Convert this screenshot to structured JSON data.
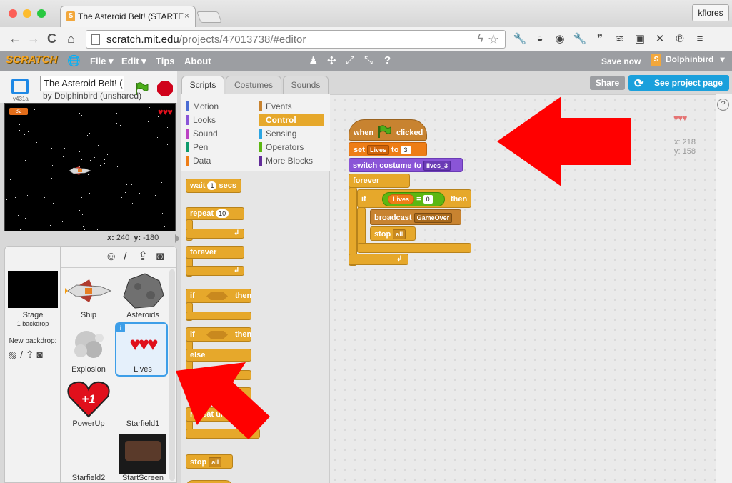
{
  "browser": {
    "tab_title": "The Asteroid Belt! (STARTE",
    "tab_favicon": "S",
    "tab_close": "×",
    "user": "kflores",
    "url_host": "scratch.mit.edu",
    "url_path": "/projects/47013738/#editor",
    "nav_back": "←",
    "nav_forward": "→",
    "nav_reload": "C",
    "nav_home": "⌂",
    "url_bolt": "ϟ",
    "url_star": "☆",
    "extensions": [
      "wrench-icon",
      "pocket-icon",
      "mask-icon",
      "wrench-icon",
      "hangouts-icon",
      "layers-icon",
      "window-icon",
      "kaltura-icon",
      "pinterest-icon",
      "menu-icon"
    ],
    "extension_glyphs": [
      "🔧",
      "◒",
      "◉",
      "🔧",
      "❞",
      "≋",
      "▣",
      "✕",
      "℗",
      "≡"
    ]
  },
  "scratch_menu": {
    "logo": "SCRATCH",
    "globe": "🌐",
    "file": "File ▾",
    "edit": "Edit ▾",
    "tips": "Tips",
    "about": "About",
    "tool_glyphs": [
      "♟",
      "✣",
      "⤢",
      "⤡",
      "?"
    ],
    "save_now": "Save now",
    "username": "Dolphinbird",
    "user_badge": "S",
    "user_caret": "▾"
  },
  "stage_header": {
    "version": "v431a",
    "project_title": "The Asteroid Belt! (",
    "author_line": "by Dolphinbird (unshared)"
  },
  "stage": {
    "score": "32",
    "hearts": "♥♥♥",
    "mouse_x_label": "x:",
    "mouse_x": "240",
    "mouse_y_label": "y:",
    "mouse_y": "-180"
  },
  "sprite_pane": {
    "toolbar_glyphs": [
      "☺",
      "/",
      "⇪",
      "◙"
    ],
    "stage_label": "Stage",
    "backdrop_count": "1 backdrop",
    "new_backdrop_label": "New backdrop:",
    "new_backdrop_tools": "▨ / ⇪ ◙",
    "info": "i",
    "sprites": [
      "Ship",
      "Asteroids",
      "Explosion",
      "Lives",
      "PowerUp",
      "Starfield1",
      "Starfield2",
      "StartScreen"
    ],
    "powerup_text": "+1",
    "selected_sprite": "Lives"
  },
  "tabs": [
    "Scripts",
    "Costumes",
    "Sounds"
  ],
  "active_tab": "Scripts",
  "categories": [
    {
      "label": "Motion",
      "color": "#4a6cd4"
    },
    {
      "label": "Looks",
      "color": "#8a55d7"
    },
    {
      "label": "Sound",
      "color": "#bb42c3"
    },
    {
      "label": "Pen",
      "color": "#0e9a6c"
    },
    {
      "label": "Data",
      "color": "#ee7d16"
    },
    {
      "label": "Events",
      "color": "#c88330"
    },
    {
      "label": "Control",
      "color": "#e6a82b"
    },
    {
      "label": "Sensing",
      "color": "#2ca5e2"
    },
    {
      "label": "Operators",
      "color": "#5cb712"
    },
    {
      "label": "More Blocks",
      "color": "#632d99"
    }
  ],
  "palette": {
    "wait": "wait",
    "wait_val": "1",
    "wait_unit": "secs",
    "repeat": "repeat",
    "repeat_val": "10",
    "forever": "forever",
    "if": "if",
    "then": "then",
    "else": "else",
    "repeat_until": "repeat until",
    "stop": "stop",
    "stop_val": "all",
    "loop_arrow": "↲"
  },
  "script": {
    "when": "when",
    "clicked": "clicked",
    "set": "set",
    "set_var": "Lives",
    "to": "to",
    "set_val": "3",
    "switch_costume": "switch costume to",
    "costume": "lives_3",
    "forever": "forever",
    "if": "if",
    "cond_var": "Lives",
    "eq": "=",
    "cond_val": "0",
    "then": "then",
    "broadcast": "broadcast",
    "message": "GameOver",
    "stop": "stop",
    "stop_val": "all",
    "loop_arrow": "↲"
  },
  "right_info": {
    "hearts": "♥♥♥",
    "x": "x: 218",
    "y": "y: 158"
  },
  "buttons": {
    "share": "Share",
    "see_project": "See project page",
    "see_project_icon": "⟳",
    "help": "?"
  },
  "colors": {
    "annotation_arrow": "#ff0000",
    "control": "#e6a82b",
    "events": "#c88330",
    "data": "#ee7d16",
    "selection": "#3d9ee8"
  }
}
